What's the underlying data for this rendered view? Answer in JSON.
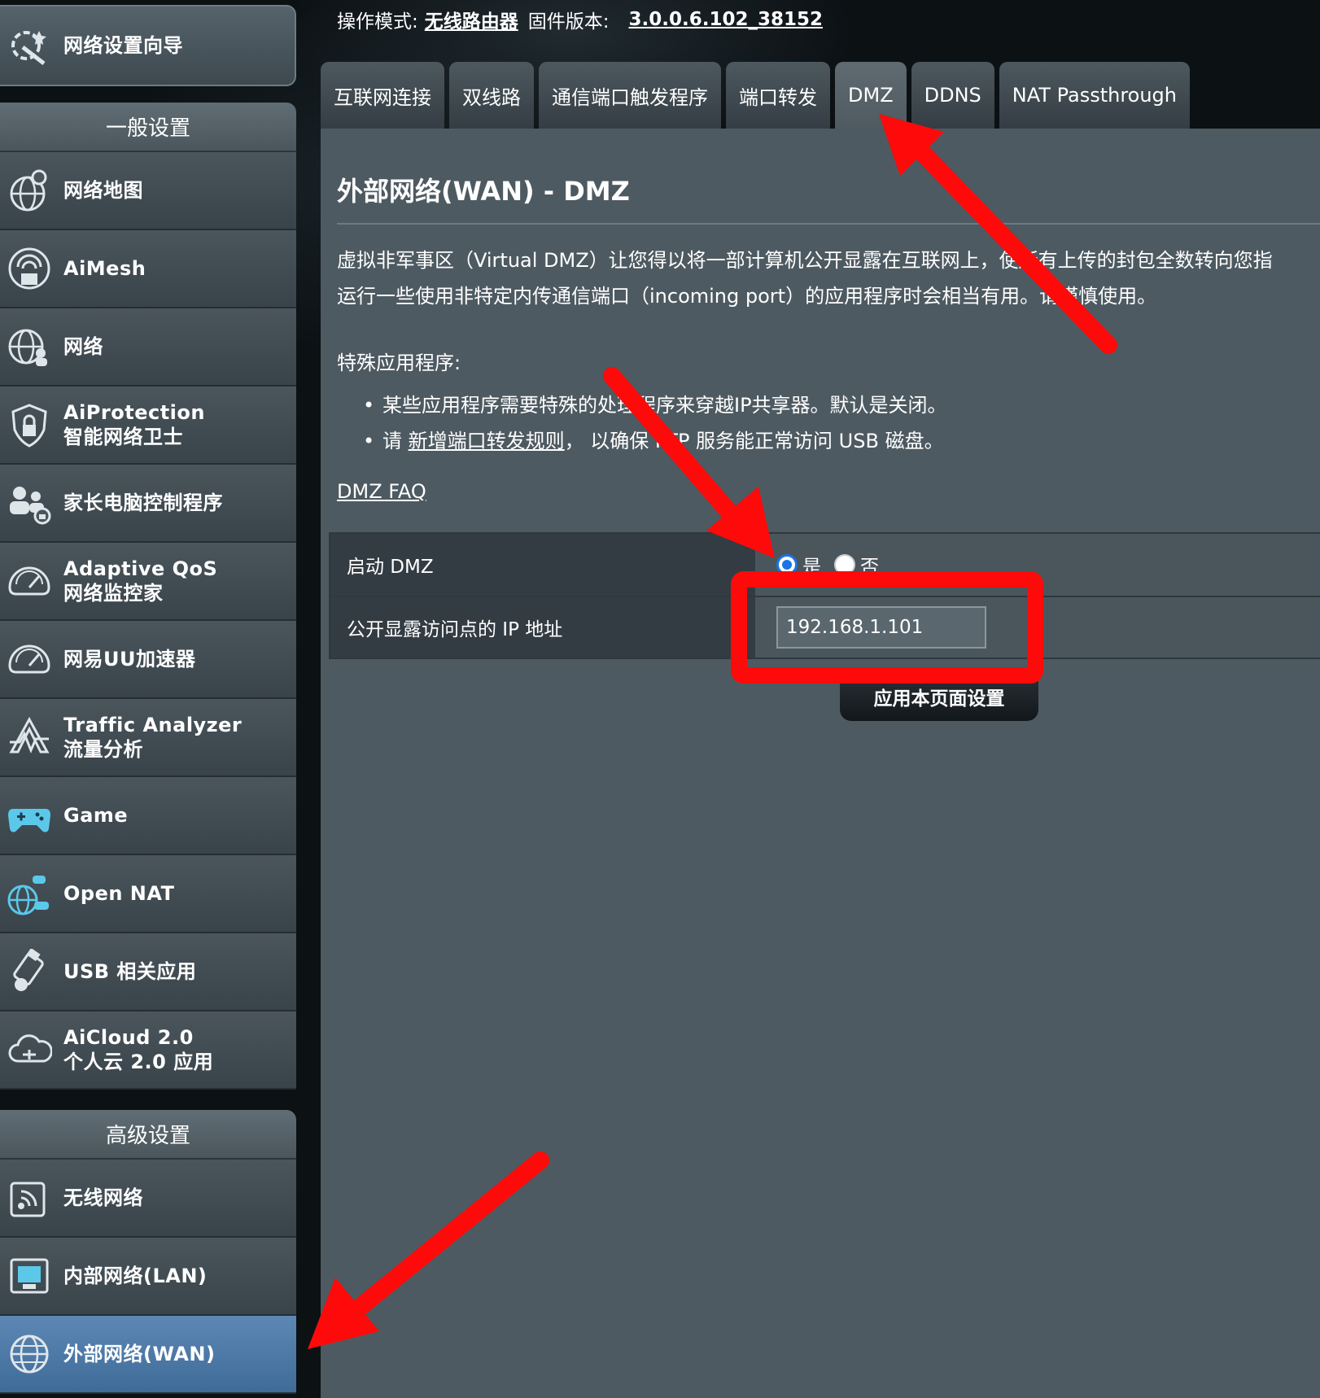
{
  "topbar": {
    "mode_label": "操作模式:",
    "mode_value": "无线路由器",
    "firmware_label": "固件版本:",
    "firmware_value": "3.0.0.6.102_38152"
  },
  "sidebar": {
    "quick_setup": {
      "label": "网络设置向导",
      "icon": "wizard-icon"
    },
    "general_header": "一般设置",
    "general_items": [
      {
        "label": "网络地图",
        "icon": "network-map-icon"
      },
      {
        "label": "AiMesh",
        "icon": "aimesh-icon"
      },
      {
        "label": "网络",
        "icon": "globe-people-icon"
      },
      {
        "label": "AiProtection",
        "label2": "智能网络卫士",
        "icon": "shield-lock-icon"
      },
      {
        "label": "家长电脑控制程序",
        "icon": "parental-control-icon"
      },
      {
        "label": "Adaptive QoS",
        "label2": "网络监控家",
        "icon": "speedometer-icon"
      },
      {
        "label": "网易UU加速器",
        "icon": "speedometer-icon"
      },
      {
        "label": "Traffic Analyzer",
        "label2": "流量分析",
        "icon": "traffic-analyzer-icon"
      },
      {
        "label": "Game",
        "icon": "gamepad-icon"
      },
      {
        "label": "Open NAT",
        "icon": "open-nat-icon"
      },
      {
        "label": "USB 相关应用",
        "icon": "usb-icon"
      },
      {
        "label": "AiCloud 2.0",
        "label2": "个人云 2.0 应用",
        "icon": "cloud-icon"
      }
    ],
    "advanced_header": "高级设置",
    "advanced_items": [
      {
        "label": "无线网络",
        "icon": "wireless-icon"
      },
      {
        "label": "内部网络(LAN)",
        "icon": "lan-icon"
      },
      {
        "label": "外部网络(WAN)",
        "icon": "globe-icon",
        "active": true
      }
    ]
  },
  "tabs": [
    "互联网连接",
    "双线路",
    "通信端口触发程序",
    "端口转发",
    "DMZ",
    "DDNS",
    "NAT Passthrough"
  ],
  "active_tab": "DMZ",
  "main": {
    "title": "外部网络(WAN) - DMZ",
    "desc_line1": "虚拟非军事区（Virtual DMZ）让您得以将一部计算机公开显露在互联网上，使所有上传的封包全数转向您指",
    "desc_line2": "运行一些使用非特定内传通信端口（incoming port）的应用程序时会相当有用。请谨慎使用。",
    "special_title": "特殊应用程序:",
    "bullet1": "某些应用程序需要特殊的处理程序来穿越IP共享器。默认是关闭。",
    "bullet2_prefix": "请 ",
    "bullet2_link": "新增端口转发规则",
    "bullet2_suffix": "， 以确保 FTP 服务能正常访问 USB 磁盘。",
    "faq_link": "DMZ FAQ",
    "enable_label": "启动 DMZ",
    "radio_yes": "是",
    "radio_no": "否",
    "enable_selected": "是",
    "ip_label": "公开显露访问点的 IP 地址",
    "ip_value": "192.168.1.101",
    "apply_button": "应用本页面设置"
  },
  "colors": {
    "annotation": "#ff0a0a",
    "active_item": "#4d7aaa",
    "radio_checked": "#1a73e8"
  }
}
